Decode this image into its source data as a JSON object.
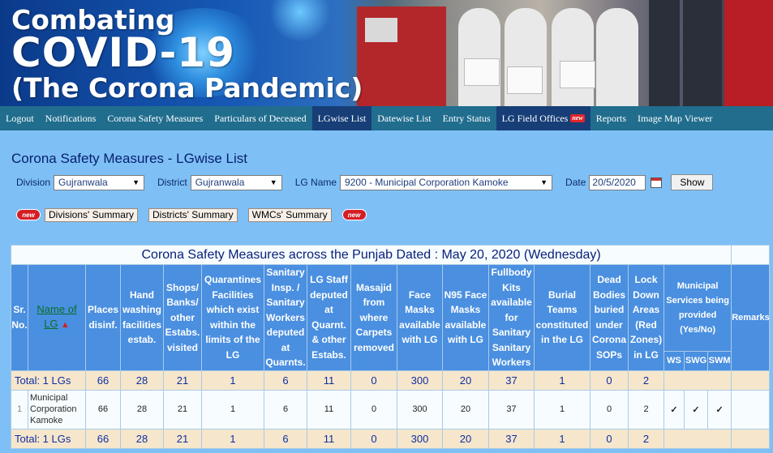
{
  "banner": {
    "line1": "Combating",
    "line2": "COVID-19",
    "line3": "(The Corona Pandemic)"
  },
  "nav": {
    "items": [
      {
        "label": "Logout"
      },
      {
        "label": "Notifications"
      },
      {
        "label": "Corona Safety Measures"
      },
      {
        "label": "Particulars of Deceased"
      },
      {
        "label": "LGwise List"
      },
      {
        "label": "Datewise List"
      },
      {
        "label": "Entry Status"
      },
      {
        "label": "LG Field Offices"
      },
      {
        "label": "Reports"
      },
      {
        "label": "Image Map Viewer"
      }
    ],
    "active_index": 4,
    "badge": "new"
  },
  "page_title": "Corona Safety Measures - LGwise List",
  "filters": {
    "division_label": "Division",
    "division_value": "Gujranwala",
    "district_label": "District",
    "district_value": "Gujranwala",
    "lg_label": "LG Name",
    "lg_value": "9200 - Municipal Corporation Kamoke",
    "date_label": "Date",
    "date_value": "20/5/2020",
    "show_label": "Show"
  },
  "summaries": {
    "new_badge": "new",
    "divisions": "Divisions' Summary",
    "districts": "Districts' Summary",
    "wmcs": "WMCs' Summary"
  },
  "table": {
    "caption": "Corona Safety Measures across the Punjab Dated : May 20, 2020 (Wednesday)",
    "headers": {
      "sr": "Sr. No.",
      "lg": "Name of LG",
      "places": "Places disinf.",
      "hand": "Hand washing facilities estab.",
      "shops": "Shops/ Banks/ other Estabs. visited",
      "quarantine": "Quarantines Facilities which exist within the limits of the LG",
      "sanitary": "Sanitary Insp. / Sanitary Workers deputed at Quarnts.",
      "lgstaff": "LG Staff deputed at Quarnt. & other Estabs.",
      "masajid": "Masajid from where Carpets removed",
      "face": "Face Masks available with LG",
      "n95": "N95 Face Masks available with LG",
      "fullbody": "Fullbody Kits available for Sanitary Sanitary Workers",
      "burial": "Burial Teams constituted in the LG",
      "dead": "Dead Bodies buried under Corona SOPs",
      "lockdown": "Lock Down Areas (Red Zones) in LG",
      "municipal": "Municipal Services being provided (Yes/No)",
      "ws": "WS",
      "swg": "SWG",
      "swm": "SWM",
      "remarks": "Remarks"
    },
    "total_label": "Total: 1 LGs",
    "totals": [
      "66",
      "28",
      "21",
      "1",
      "6",
      "11",
      "0",
      "300",
      "20",
      "37",
      "1",
      "0",
      "2"
    ],
    "rows": [
      {
        "sr": "1",
        "name": "Municipal Corporation Kamoke",
        "values": [
          "66",
          "28",
          "21",
          "1",
          "6",
          "11",
          "0",
          "300",
          "20",
          "37",
          "1",
          "0",
          "2"
        ],
        "ws": "✓",
        "swg": "✓",
        "swm": "✓",
        "remarks": ""
      }
    ]
  }
}
